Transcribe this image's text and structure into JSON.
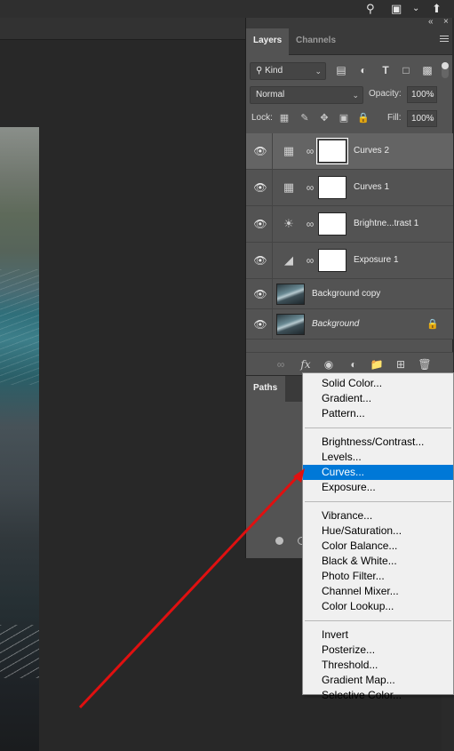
{
  "topbar": {
    "search_icon": "search-icon",
    "workspace_icon": "workspace-icon",
    "share_icon": "share-icon",
    "dropdown_glyph": "⌵"
  },
  "panel_controls": {
    "collapse_glyph": "«",
    "close_glyph": "×"
  },
  "layers_panel": {
    "tabs": [
      "Layers",
      "Channels"
    ],
    "filter": {
      "label": "Kind",
      "icons": [
        "image-filter-icon",
        "adjustment-filter-icon",
        "type-filter-icon",
        "shape-filter-icon",
        "smart-object-filter-icon"
      ]
    },
    "blend_mode": "Normal",
    "opacity_label": "Opacity:",
    "opacity_value": "100%",
    "lock_label": "Lock:",
    "fill_label": "Fill:",
    "fill_value": "100%",
    "layers": [
      {
        "name": "Curves 2",
        "type": "curves",
        "selected": true
      },
      {
        "name": "Curves 1",
        "type": "curves",
        "selected": false
      },
      {
        "name": "Brightne...trast 1",
        "type": "brightness",
        "selected": false
      },
      {
        "name": "Exposure 1",
        "type": "exposure",
        "selected": false
      },
      {
        "name": "Background copy",
        "type": "image",
        "selected": false
      },
      {
        "name": "Background",
        "type": "image",
        "selected": false,
        "locked": true
      }
    ]
  },
  "paths_panel": {
    "tab": "Paths"
  },
  "menu": {
    "groups": [
      [
        "Solid Color...",
        "Gradient...",
        "Pattern..."
      ],
      [
        "Brightness/Contrast...",
        "Levels...",
        "Curves...",
        "Exposure..."
      ],
      [
        "Vibrance...",
        "Hue/Saturation...",
        "Color Balance...",
        "Black & White...",
        "Photo Filter...",
        "Channel Mixer...",
        "Color Lookup..."
      ],
      [
        "Invert",
        "Posterize...",
        "Threshold...",
        "Gradient Map...",
        "Selective Color..."
      ]
    ],
    "highlighted": "Curves..."
  },
  "colors": {
    "panel_bg": "#535353",
    "menu_highlight": "#0078d7",
    "arrow": "#e01010"
  }
}
